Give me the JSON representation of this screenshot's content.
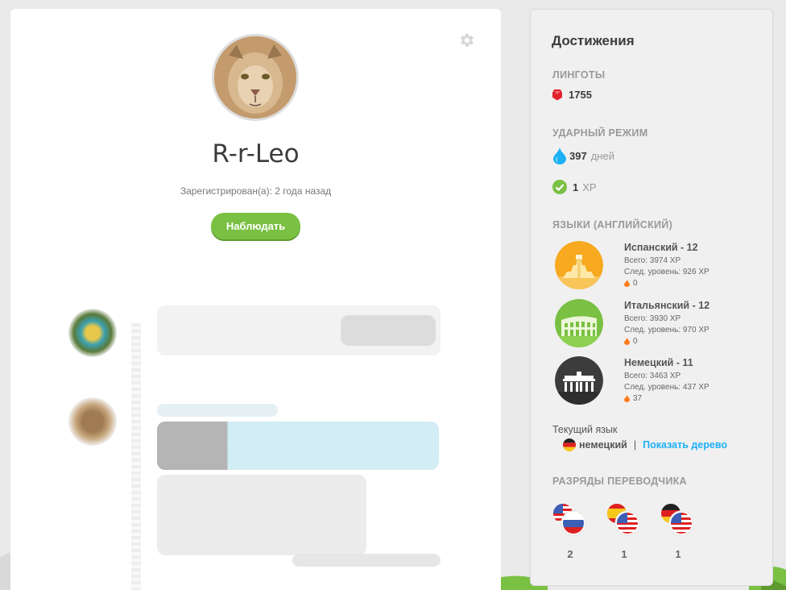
{
  "profile": {
    "username": "R-r-Leo",
    "registered": "Зарегистрирован(а): 2 года назад",
    "follow_label": "Наблюдать"
  },
  "achievements": {
    "title": "Достижения",
    "lingots_heading": "ЛИНГОТЫ",
    "lingots": "1755",
    "streak_heading": "УДАРНЫЙ РЕЖИМ",
    "streak_days": "397",
    "streak_unit": "дней",
    "xp_value": "1",
    "xp_unit": "XP",
    "languages_heading": "ЯЗЫКИ (АНГЛИЙСКИЙ)",
    "languages": [
      {
        "name": "Испанский - 12",
        "total": "Всего: 3974 XP",
        "next": "След. уровень: 926 XP",
        "streak": "0",
        "icon": "spanish-pyramid-icon",
        "color": "#f7a91f"
      },
      {
        "name": "Итальянский - 12",
        "total": "Всего: 3930 XP",
        "next": "След. уровень: 970 XP",
        "streak": "0",
        "icon": "italian-colosseum-icon",
        "color": "#7ac043"
      },
      {
        "name": "Немецкий - 11",
        "total": "Всего: 3463 XP",
        "next": "След. уровень: 437 XP",
        "streak": "37",
        "icon": "german-gate-icon",
        "color": "#3c3c3c"
      }
    ],
    "current_language_label": "Текущий язык",
    "current_language": "немецкий",
    "separator": "|",
    "show_tree_link": "Показать дерево",
    "translator_heading": "РАЗРЯДЫ ПЕРЕВОДЧИКА",
    "tiers": [
      {
        "from": "english-flag-icon",
        "to": "russian-flag-icon",
        "count": "2"
      },
      {
        "from": "spanish-flag-icon",
        "to": "english-flag-icon",
        "count": "1"
      },
      {
        "from": "german-flag-icon",
        "to": "english-flag-icon",
        "count": "1"
      }
    ]
  },
  "colors": {
    "accent_green": "#7ac043",
    "link_blue": "#1cb0f6",
    "lingot_red": "#e0232e",
    "streak_blue": "#1cb0f6"
  }
}
